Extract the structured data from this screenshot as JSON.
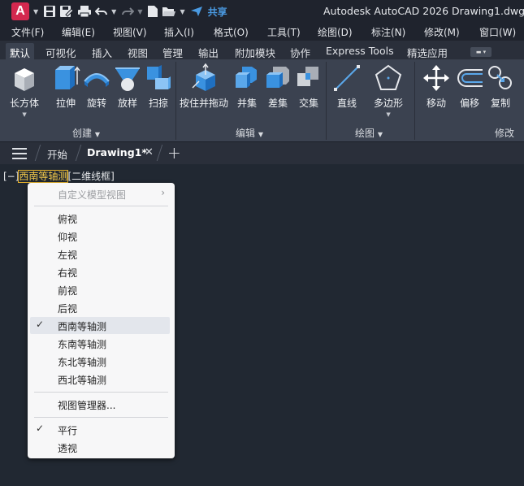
{
  "app": {
    "logo_letter": "A",
    "title": "Autodesk AutoCAD 2026    Drawing1.dwg",
    "share_label": "共享"
  },
  "menubar": [
    "文件(F)",
    "编辑(E)",
    "视图(V)",
    "插入(I)",
    "格式(O)",
    "工具(T)",
    "绘图(D)",
    "标注(N)",
    "修改(M)",
    "窗口(W)"
  ],
  "ribbon_tabs": [
    "默认",
    "可视化",
    "插入",
    "视图",
    "管理",
    "输出",
    "附加模块",
    "协作",
    "Express Tools",
    "精选应用"
  ],
  "ribbon": {
    "buttons": {
      "box": "长方体",
      "extrude": "拉伸",
      "revolve": "旋转",
      "loft": "放样",
      "sweep": "扫掠",
      "presspull": "按住并拖动",
      "union": "并集",
      "subtract": "差集",
      "intersect": "交集",
      "line": "直线",
      "polygon": "多边形",
      "move": "移动",
      "offset": "偏移",
      "copy": "复制"
    },
    "panels": {
      "create": "创建",
      "edit": "编辑",
      "draw": "绘图",
      "modify": "修改"
    }
  },
  "doc_tabs": {
    "start": "开始",
    "drawing": "Drawing1*"
  },
  "viewport_controls": {
    "minus": "[−]",
    "view": "西南等轴测",
    "style": "[二维线框]"
  },
  "context_menu": {
    "custom_views": "自定义模型视图",
    "items": [
      "俯视",
      "仰视",
      "左视",
      "右视",
      "前视",
      "后视",
      "西南等轴测",
      "东南等轴测",
      "东北等轴测",
      "西北等轴测"
    ],
    "selected_item": "西南等轴测",
    "view_manager": "视图管理器...",
    "parallel": "平行",
    "perspective": "透视"
  },
  "colors": {
    "background": "#212832",
    "ribbon": "#3b4250",
    "highlight": "#f3c94a",
    "share_blue": "#4a9ae2",
    "logo_red": "#d4284f"
  }
}
